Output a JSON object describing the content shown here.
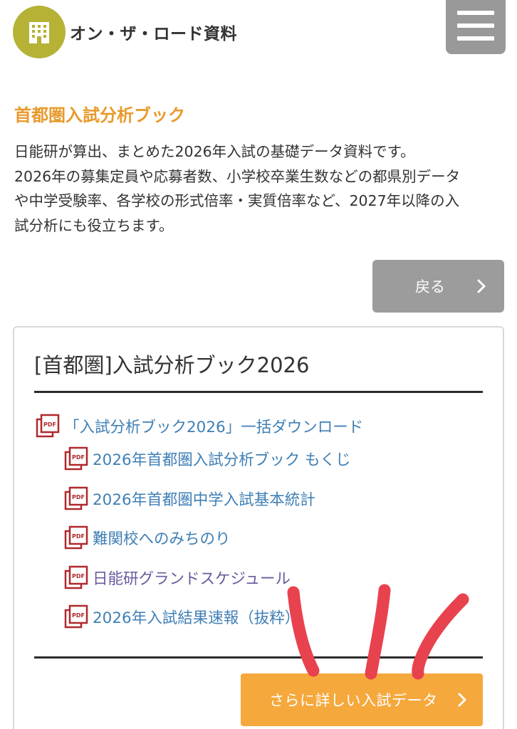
{
  "header": {
    "logo_icon": "building-icon",
    "site_title": "オン・ザ・ロード資料",
    "menu_icon": "hamburger-menu-icon"
  },
  "intro": {
    "heading": "首都圏入試分析ブック",
    "description_lines": [
      "日能研が算出、まとめた2026年入試の基礎データ資料です。",
      "2026年の募集定員や応募者数、小学校卒業生数などの都県別データ",
      "や中学受験率、各学校の形式倍率・実質倍率など、2027年以降の入",
      "試分析にも役立ちます。"
    ]
  },
  "back_button": {
    "label": "戻る",
    "icon": "chevron-right-icon"
  },
  "card": {
    "title": "[首都圏]入試分析ブック2026",
    "links": [
      {
        "label": "「入試分析ブック2026」一括ダウンロード",
        "icon": "pdf-icon"
      },
      {
        "label": "2026年首都圏入試分析ブック もくじ",
        "icon": "pdf-icon"
      },
      {
        "label": "2026年首都圏中学入試基本統計",
        "icon": "pdf-icon"
      },
      {
        "label": "難関校へのみちのり",
        "icon": "pdf-icon"
      },
      {
        "label": "日能研グランドスケジュール",
        "icon": "pdf-icon"
      },
      {
        "label": "2026年入試結果速報（抜粋）",
        "icon": "pdf-icon"
      }
    ],
    "more_button": {
      "label": "さらに詳しい入試データ",
      "icon": "chevron-right-icon"
    }
  },
  "colors": {
    "accent_orange": "#e89a2c",
    "button_orange": "#f5a83c",
    "logo_olive": "#b5b236",
    "link_blue": "#3f7fb5",
    "link_visited": "#6a5a9c",
    "pdf_red": "#b0282c",
    "annotation_red": "#e8424e",
    "gray_button": "#9c9c9c"
  }
}
